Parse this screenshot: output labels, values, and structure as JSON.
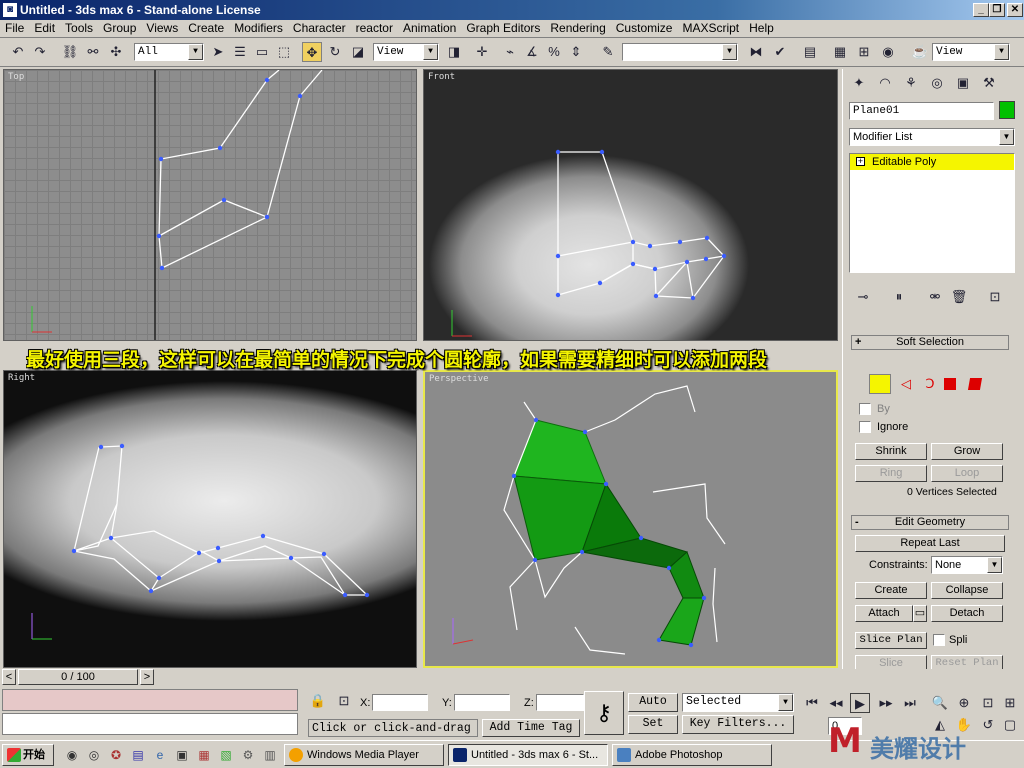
{
  "window": {
    "title": "Untitled - 3ds max 6 - Stand-alone License",
    "minimize": "_",
    "maximize": "❐",
    "close": "✕"
  },
  "menu": [
    "File",
    "Edit",
    "Tools",
    "Group",
    "Views",
    "Create",
    "Modifiers",
    "Character",
    "reactor",
    "Animation",
    "Graph Editors",
    "Rendering",
    "Customize",
    "MAXScript",
    "Help"
  ],
  "toolbar": {
    "selection_filter": "All",
    "ref_coord": "View",
    "named_selection": "",
    "view_right": "View"
  },
  "viewports": {
    "top": "Top",
    "front": "Front",
    "right": "Right",
    "perspective": "Perspective"
  },
  "subtitle": "最好使用三段，这样可以在最简单的情况下完成个圆轮廓，如果需要精细时可以添加两段",
  "command_panel": {
    "object_name": "Plane01",
    "object_color": "#00c000",
    "modifier_list": "Modifier List",
    "stack_item": "Editable Poly",
    "soft_selection": "Soft Selection",
    "by_vertex": "By",
    "ignore_backfacing": "Ignore",
    "shrink": "Shrink",
    "grow": "Grow",
    "ring": "Ring",
    "loop": "Loop",
    "selected_info": "0 Vertices Selected",
    "edit_geometry": "Edit Geometry",
    "repeat_last": "Repeat Last",
    "constraints_label": "Constraints:",
    "constraints_value": "None",
    "create": "Create",
    "collapse": "Collapse",
    "attach": "Attach",
    "detach": "Detach",
    "slice_plane": "Slice Plan",
    "split": "Spli",
    "slice": "Slice",
    "reset_plane": "Reset Plan"
  },
  "timeline": {
    "frame": "0 / 100",
    "prev": "<",
    "next": ">"
  },
  "status": {
    "x_label": "X:",
    "y_label": "Y:",
    "z_label": "Z:",
    "prompt": "Click or click-and-drag",
    "add_time_tag": "Add Time Tag",
    "auto_key": "Auto Key",
    "set_key": "Set Key",
    "key_mode": "Selected",
    "key_filters": "Key Filters...",
    "current_frame": "0"
  },
  "taskbar": {
    "start": "开始",
    "tasks": [
      "Windows Media Player",
      "Untitled - 3ds max 6 - St...",
      "Adobe Photoshop"
    ],
    "watermark": "美耀设计"
  }
}
